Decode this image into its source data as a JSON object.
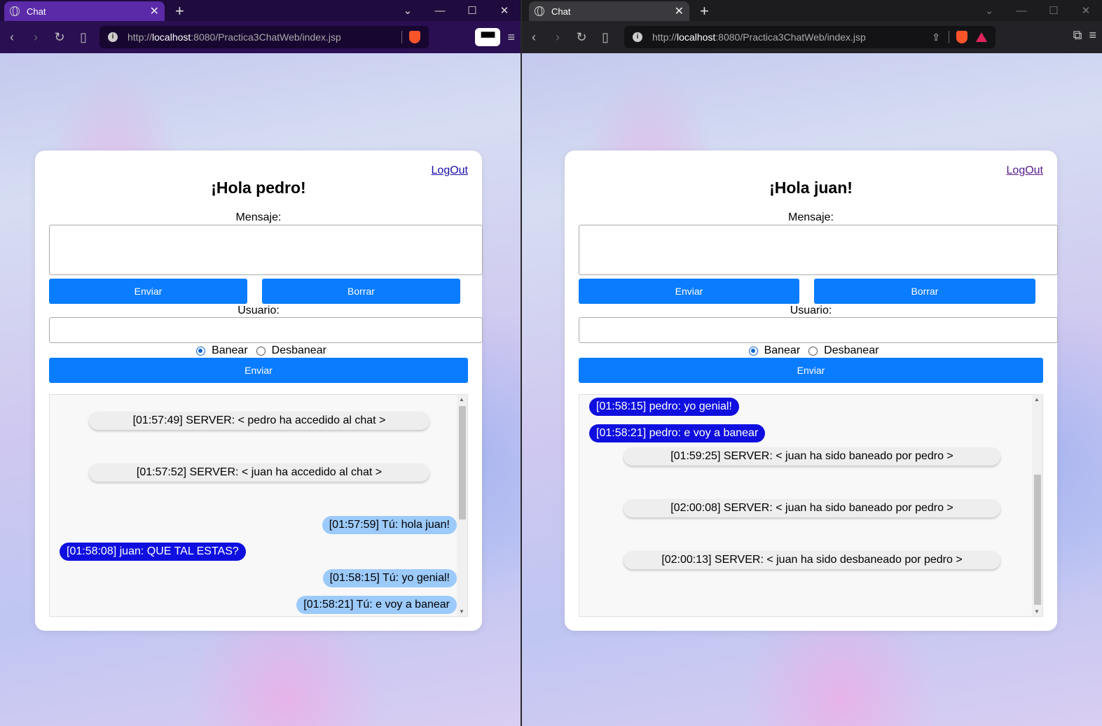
{
  "left": {
    "tab_title": "Chat",
    "url_prefix": "http://",
    "url_host": "localhost",
    "url_rest": ":8080/Practica3ChatWeb/index.jsp",
    "logout": "LogOut",
    "greeting": "¡Hola pedro!",
    "message_label": "Mensaje:",
    "send_label": "Enviar",
    "clear_label": "Borrar",
    "user_label": "Usuario:",
    "ban_label": "Banear",
    "unban_label": "Desbanear",
    "send_user_label": "Enviar",
    "messages": {
      "m0": "[01:57:49] SERVER: < pedro ha accedido al chat >",
      "m1": "[01:57:52] SERVER: < juan ha accedido al chat >",
      "m2": "[01:57:59] Tú: hola juan!",
      "m3": "[01:58:08] juan: QUE TAL ESTAS?",
      "m4": "[01:58:15] Tú: yo genial!",
      "m5": "[01:58:21] Tú: e voy a banear"
    }
  },
  "right": {
    "tab_title": "Chat",
    "url_prefix": "http://",
    "url_host": "localhost",
    "url_rest": ":8080/Practica3ChatWeb/index.jsp",
    "logout": "LogOut",
    "greeting": "¡Hola juan!",
    "message_label": "Mensaje:",
    "send_label": "Enviar",
    "clear_label": "Borrar",
    "user_label": "Usuario:",
    "ban_label": "Banear",
    "unban_label": "Desbanear",
    "send_user_label": "Enviar",
    "messages": {
      "m0": "[01:58:15] pedro: yo genial!",
      "m1": "[01:58:21] pedro: e voy a banear",
      "m2": "[01:59:25] SERVER: < juan ha sido baneado por pedro >",
      "m3": "[02:00:08] SERVER: < juan ha sido baneado por pedro >",
      "m4": "[02:00:13] SERVER: < juan ha sido desbaneado por pedro >"
    }
  },
  "colors": {
    "button_blue": "#0a7cff",
    "own_bubble": "#9ccafa",
    "other_bubble": "#0f0fe0"
  }
}
